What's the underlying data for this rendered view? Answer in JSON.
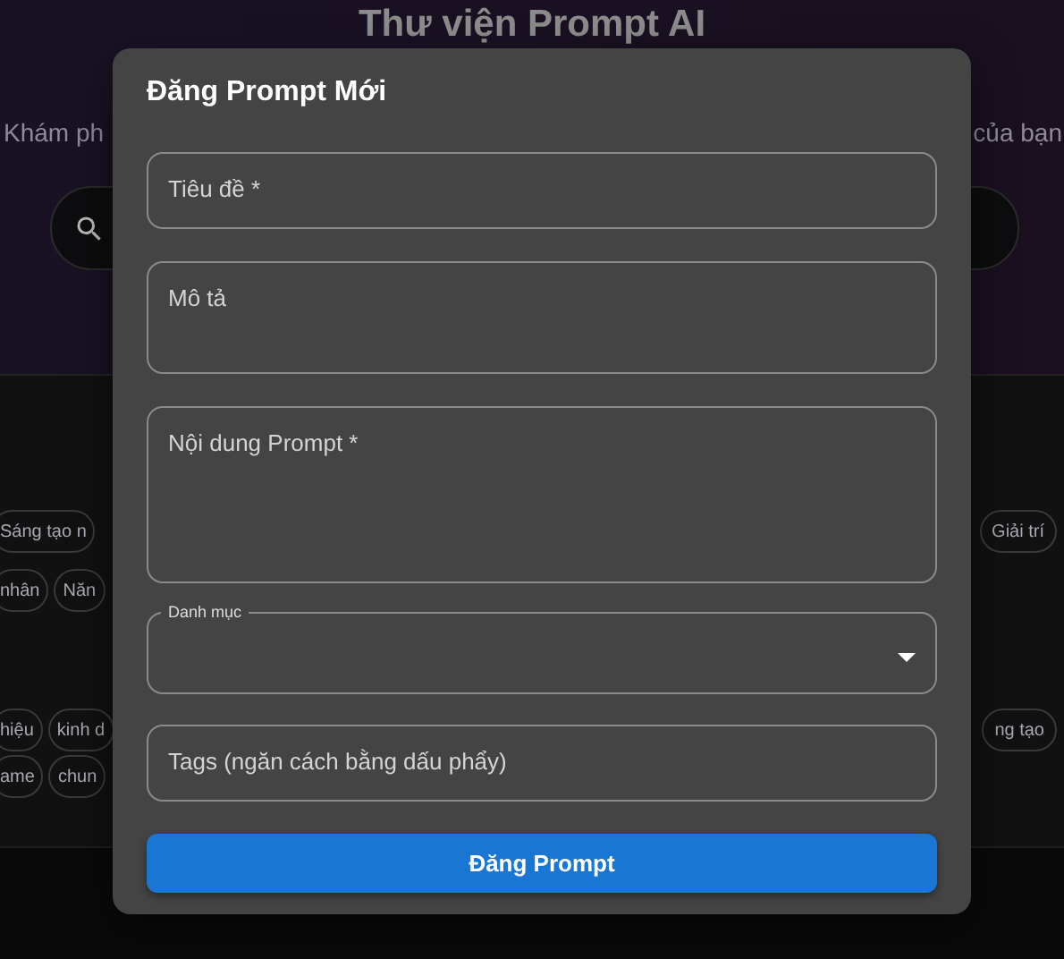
{
  "page": {
    "title": "Thư viện Prompt AI",
    "subtitle_left": "Khám ph",
    "subtitle_right": "của bạn"
  },
  "tag_rows": [
    {
      "left": [
        "Sáng tạo n"
      ],
      "right": [
        "Giải trí"
      ]
    },
    {
      "left": [
        "nhân",
        "Năn"
      ],
      "right": []
    },
    {
      "left": [
        "hiệu",
        "kinh d"
      ],
      "right": [
        "ng tạo"
      ]
    },
    {
      "left": [
        "ame",
        "chun"
      ],
      "right": []
    }
  ],
  "dialog": {
    "title": "Đăng Prompt Mới",
    "fields": [
      {
        "kind": "text",
        "label": "Tiêu đề *"
      },
      {
        "kind": "textarea",
        "label": "Mô tả"
      },
      {
        "kind": "editor",
        "label": "Nội dung Prompt *"
      },
      {
        "kind": "select",
        "label": "Danh mục"
      },
      {
        "kind": "text",
        "label": "Tags (ngăn cách bằng dấu phẩy)"
      }
    ],
    "submit": "Đăng Prompt"
  }
}
